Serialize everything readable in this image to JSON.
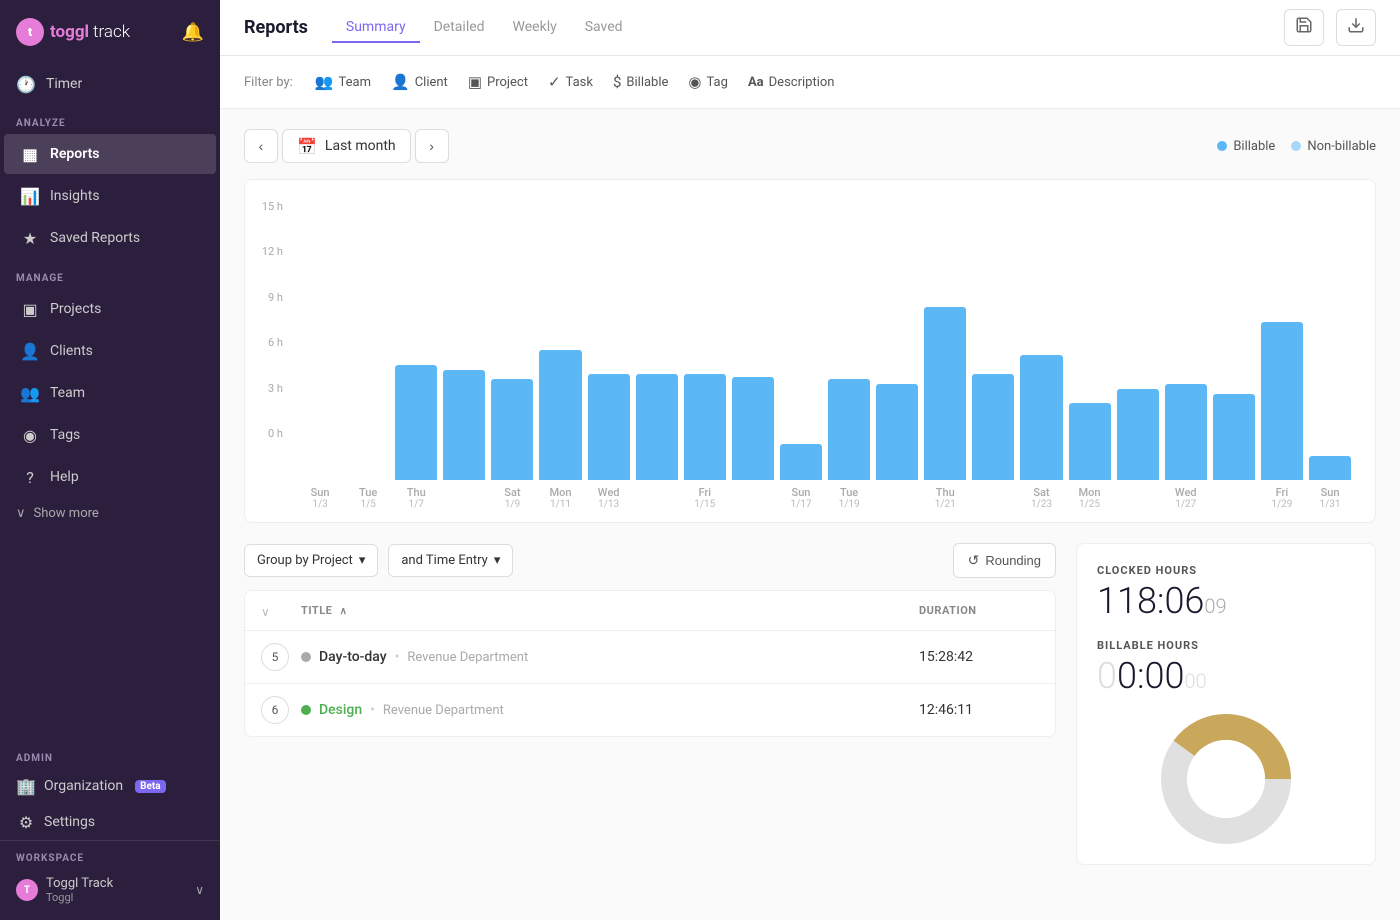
{
  "sidebar": {
    "logo": {
      "toggl": "toggl",
      "track": "track"
    },
    "timer": "Timer",
    "sections": {
      "analyze": {
        "label": "ANALYZE",
        "items": [
          {
            "id": "reports",
            "icon": "▦",
            "label": "Reports",
            "active": true
          },
          {
            "id": "insights",
            "icon": "★",
            "label": "Insights",
            "active": false
          },
          {
            "id": "saved-reports",
            "icon": "☆",
            "label": "Saved Reports",
            "active": false
          }
        ]
      },
      "manage": {
        "label": "MANAGE",
        "items": [
          {
            "id": "projects",
            "icon": "▣",
            "label": "Projects",
            "active": false
          },
          {
            "id": "clients",
            "icon": "👤",
            "label": "Clients",
            "active": false
          },
          {
            "id": "team",
            "icon": "👥",
            "label": "Team",
            "active": false
          },
          {
            "id": "tags",
            "icon": "◉",
            "label": "Tags",
            "active": false
          },
          {
            "id": "help",
            "icon": "?",
            "label": "Help",
            "active": false
          }
        ]
      }
    },
    "show_more": "Show more",
    "admin": {
      "label": "ADMIN",
      "items": [
        {
          "id": "organization",
          "icon": "🏢",
          "label": "Organization",
          "badge": "Beta"
        },
        {
          "id": "settings",
          "icon": "⚙",
          "label": "Settings"
        }
      ]
    },
    "workspace": {
      "label": "WORKSPACE",
      "name": "Toggl Track",
      "sub": "Toggl"
    }
  },
  "header": {
    "title": "Reports",
    "tabs": [
      {
        "id": "summary",
        "label": "Summary",
        "active": true
      },
      {
        "id": "detailed",
        "label": "Detailed",
        "active": false
      },
      {
        "id": "weekly",
        "label": "Weekly",
        "active": false
      },
      {
        "id": "saved",
        "label": "Saved",
        "active": false
      }
    ],
    "save_icon": "💾",
    "download_icon": "⬇"
  },
  "filters": {
    "label": "Filter by:",
    "items": [
      {
        "id": "team",
        "icon": "👥",
        "label": "Team"
      },
      {
        "id": "client",
        "icon": "👤",
        "label": "Client"
      },
      {
        "id": "project",
        "icon": "▣",
        "label": "Project"
      },
      {
        "id": "task",
        "icon": "✓",
        "label": "Task"
      },
      {
        "id": "billable",
        "icon": "$",
        "label": "Billable"
      },
      {
        "id": "tag",
        "icon": "◉",
        "label": "Tag"
      },
      {
        "id": "description",
        "icon": "Aa",
        "label": "Description"
      }
    ]
  },
  "date_range": {
    "label": "Last month",
    "prev_label": "‹",
    "next_label": "›"
  },
  "legend": {
    "billable": {
      "label": "Billable",
      "color": "#5bb8f5"
    },
    "non_billable": {
      "label": "Non-billable",
      "color": "#a8d8f8"
    }
  },
  "chart": {
    "y_labels": [
      "15 h",
      "12 h",
      "9 h",
      "6 h",
      "3 h",
      "0 h"
    ],
    "max_h": 15,
    "bars": [
      {
        "day": "Sun",
        "date": "1/3",
        "height_pct": 0
      },
      {
        "day": "Tue",
        "date": "1/5",
        "height_pct": 0
      },
      {
        "day": "Thu",
        "date": "1/7",
        "height_pct": 48
      },
      {
        "day": "",
        "date": "",
        "height_pct": 46
      },
      {
        "day": "Sat",
        "date": "1/9",
        "height_pct": 42
      },
      {
        "day": "Mon",
        "date": "1/11",
        "height_pct": 54
      },
      {
        "day": "Wed",
        "date": "1/13",
        "height_pct": 44
      },
      {
        "day": "",
        "date": "",
        "height_pct": 44
      },
      {
        "day": "Fri",
        "date": "1/15",
        "height_pct": 44
      },
      {
        "day": "",
        "date": "",
        "height_pct": 43
      },
      {
        "day": "Sun",
        "date": "1/17",
        "height_pct": 15
      },
      {
        "day": "Tue",
        "date": "1/19",
        "height_pct": 42
      },
      {
        "day": "",
        "date": "",
        "height_pct": 40
      },
      {
        "day": "Thu",
        "date": "1/21",
        "height_pct": 72
      },
      {
        "day": "",
        "date": "",
        "height_pct": 44
      },
      {
        "day": "Sat",
        "date": "1/23",
        "height_pct": 52
      },
      {
        "day": "Mon",
        "date": "1/25",
        "height_pct": 32
      },
      {
        "day": "",
        "date": "",
        "height_pct": 38
      },
      {
        "day": "Wed",
        "date": "1/27",
        "height_pct": 40
      },
      {
        "day": "",
        "date": "",
        "height_pct": 36
      },
      {
        "day": "Fri",
        "date": "1/29",
        "height_pct": 66
      },
      {
        "day": "Sun",
        "date": "1/31",
        "height_pct": 10
      }
    ]
  },
  "group_controls": {
    "group_by": "Group by Project",
    "and": "and Time Entry",
    "rounding": "Rounding"
  },
  "table": {
    "cols": {
      "title": "TITLE",
      "duration": "DURATION"
    },
    "rows": [
      {
        "num": "5",
        "project": "Day-to-day",
        "dot_color": "#aaa",
        "client": "Revenue Department",
        "duration": "15:28:42"
      },
      {
        "num": "6",
        "project": "Design",
        "dot_color": "#4caf50",
        "client": "Revenue Department",
        "duration": "12:46:11"
      }
    ]
  },
  "stats": {
    "clocked": {
      "label": "CLOCKED HOURS",
      "hours": "118:06",
      "seconds": "09"
    },
    "billable": {
      "label": "BILLABLE HOURS",
      "hours": "0:00",
      "seconds": "00"
    },
    "pie": {
      "segments": [
        {
          "color": "#e0e0e0",
          "pct": 60
        },
        {
          "color": "#c9a85c",
          "pct": 40
        }
      ]
    }
  }
}
